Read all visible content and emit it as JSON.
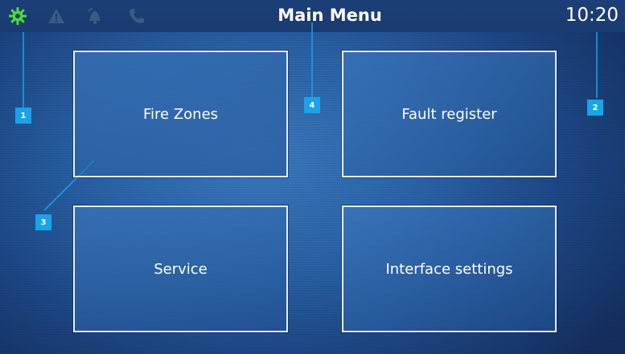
{
  "header": {
    "title": "Main Menu",
    "time": "10:20",
    "status_icons": [
      "gear-icon",
      "warning-icon",
      "bell-icon",
      "phone-icon"
    ],
    "active_color": "#4ddc3a",
    "inactive_color": "#3d5a86"
  },
  "menu": {
    "fire_zones": "Fire Zones",
    "fault_register": "Fault register",
    "service": "Service",
    "interface_settings": "Interface settings"
  },
  "callouts": [
    "1",
    "2",
    "3",
    "4"
  ]
}
